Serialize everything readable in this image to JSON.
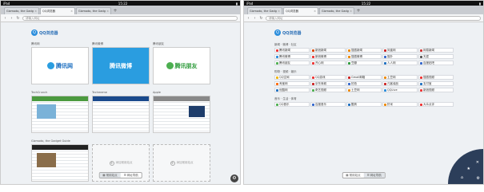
{
  "colors": {
    "accent": "#2a8ddc",
    "brand_text": "#2a6fb6"
  },
  "left": {
    "status": {
      "carrier": "iPad",
      "wifi": "≋",
      "time": "15:22",
      "battery": "▮"
    },
    "tabs": [
      {
        "label": "Gizmodo, the Gadg",
        "active": false
      },
      {
        "label": "QQ浏览器",
        "active": true
      },
      {
        "label": "Gizmodo, the Gadg",
        "active": false
      }
    ],
    "tab_add": "+",
    "url_placeholder": "请输入网址",
    "logo_text": "QQ浏览器",
    "sites": [
      {
        "title": "腾讯网",
        "type": "brand",
        "brand": "腾讯网",
        "brand_sub": "qq.com",
        "color": "#1d6fc0"
      },
      {
        "title": "腾讯微博",
        "type": "brand",
        "brand": "腾讯微博",
        "color": "#1d6fc0"
      },
      {
        "title": "腾讯朋友",
        "type": "brand",
        "brand": "腾讯朋友",
        "color": "#2e9b3b"
      },
      {
        "title": "TechCrunch",
        "type": "shot",
        "band": "#4b9a3f"
      },
      {
        "title": "Techmeme",
        "type": "shot",
        "band": "#1a4a8c"
      },
      {
        "title": "Apple",
        "type": "shot",
        "band": "#888888"
      },
      {
        "title": "Gizmodo, the Gadget Guide",
        "type": "shot",
        "band": "#222222"
      },
      {
        "title": "",
        "type": "empty",
        "label": "添加常用站点"
      },
      {
        "title": "",
        "type": "empty",
        "label": "添加常用站点"
      }
    ],
    "switch": {
      "a": "常用站点",
      "b": "网址导航"
    }
  },
  "right": {
    "status": {
      "carrier": "iPad",
      "wifi": "≋",
      "time": "15:22",
      "battery": "▮"
    },
    "tabs": [
      {
        "label": "Gizmodo, the Gadg",
        "active": false
      },
      {
        "label": "QQ浏览器",
        "active": true
      },
      {
        "label": "Gizmodo, the Gadg",
        "active": false
      }
    ],
    "tab_add": "+",
    "url_placeholder": "请输入网址",
    "logo_text": "QQ浏览器",
    "sections": [
      {
        "title": "新闻 · 微博 · 社区",
        "links": [
          {
            "label": "腾讯新闻",
            "color": "#e33"
          },
          {
            "label": "新浪新闻",
            "color": "#d40"
          },
          {
            "label": "搜狐新闻",
            "color": "#e80"
          },
          {
            "label": "凤凰网",
            "color": "#c22"
          },
          {
            "label": "网易新闻",
            "color": "#c33"
          },
          {
            "label": "腾讯微博",
            "color": "#2a8ddc"
          },
          {
            "label": "新浪微博",
            "color": "#e33"
          },
          {
            "label": "搜狐微博",
            "color": "#e80"
          },
          {
            "label": "猫扑",
            "color": "#36c"
          },
          {
            "label": "天涯",
            "color": "#555"
          },
          {
            "label": "腾讯朋友",
            "color": "#4caf50"
          },
          {
            "label": "开心网",
            "color": "#e33"
          },
          {
            "label": "豆瓣",
            "color": "#2e9b3b"
          },
          {
            "label": "人人网",
            "color": "#1d6fc0"
          },
          {
            "label": "百度贴吧",
            "color": "#36c"
          }
        ]
      },
      {
        "title": "购物 · 视频 · 娱乐",
        "links": [
          {
            "label": "QQ空间",
            "color": "#f1b400"
          },
          {
            "label": "QQ游戏",
            "color": "#e33"
          },
          {
            "label": "Gmail邮箱",
            "color": "#c22"
          },
          {
            "label": "土豆网",
            "color": "#e80"
          },
          {
            "label": "搜狐视频",
            "color": "#e33"
          },
          {
            "label": "淘宝网",
            "color": "#f60"
          },
          {
            "label": "京东商城",
            "color": "#c22"
          },
          {
            "label": "拍拍",
            "color": "#36c"
          },
          {
            "label": "凡客诚品",
            "color": "#c22"
          },
          {
            "label": "支付宝",
            "color": "#1d6fc0"
          },
          {
            "label": "优酷网",
            "color": "#1d6fc0"
          },
          {
            "label": "奇艺视频",
            "color": "#4caf50"
          },
          {
            "label": "土豆网",
            "color": "#e80"
          },
          {
            "label": "QQLive",
            "color": "#2a8ddc"
          },
          {
            "label": "新浪视频",
            "color": "#e33"
          }
        ]
      },
      {
        "title": "音乐 · 生活 · 体育",
        "links": [
          {
            "label": "QQ音乐",
            "color": "#4caf50"
          },
          {
            "label": "百度音乐",
            "color": "#36c"
          },
          {
            "label": "酷狗",
            "color": "#1d6fc0"
          },
          {
            "label": "虾米",
            "color": "#e80"
          },
          {
            "label": "大众点评",
            "color": "#e33"
          }
        ]
      }
    ],
    "switch": {
      "a": "常用站点",
      "b": "网址导航"
    },
    "fan_icons": [
      "⚙",
      "✕",
      "★",
      "⌂"
    ]
  }
}
